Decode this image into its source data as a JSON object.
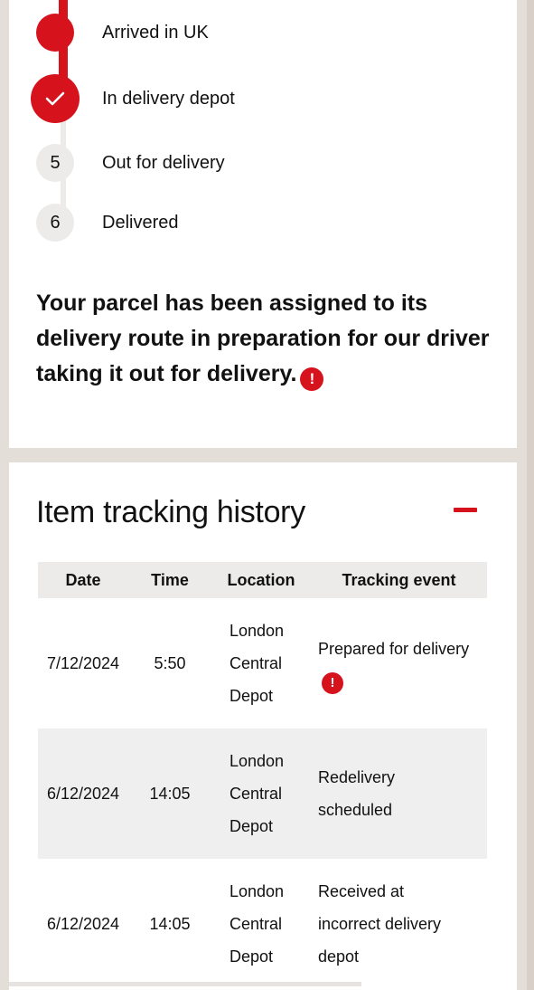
{
  "progress": {
    "completed_steps": [
      {
        "label": "Arrived in UK"
      },
      {
        "label": "In delivery depot",
        "current": true,
        "icon": "check-icon"
      }
    ],
    "pending_steps": [
      {
        "number": "5",
        "label": "Out for delivery"
      },
      {
        "number": "6",
        "label": "Delivered"
      }
    ],
    "message": "Your parcel has been assigned to its delivery route in preparation for our driver taking it out for delivery."
  },
  "history": {
    "title": "Item tracking history",
    "columns": [
      "Date",
      "Time",
      "Location",
      "Tracking event"
    ],
    "rows": [
      {
        "date": "7/12/2024",
        "time": "5:50",
        "location": [
          "London",
          "Central",
          "Depot"
        ],
        "event": [
          "Prepared for delivery"
        ],
        "has_info": true
      },
      {
        "date": "6/12/2024",
        "time": "14:05",
        "location": [
          "London",
          "Central",
          "Depot"
        ],
        "event": [
          "Redelivery",
          "scheduled"
        ],
        "has_info": false
      },
      {
        "date": "6/12/2024",
        "time": "14:05",
        "location": [
          "London",
          "Central",
          "Depot"
        ],
        "event": [
          "Received at",
          "incorrect delivery",
          "depot"
        ],
        "has_info": false
      }
    ]
  },
  "colors": {
    "accent": "#d6121d",
    "grey": "#ecebea",
    "background": "#e4ded8"
  }
}
